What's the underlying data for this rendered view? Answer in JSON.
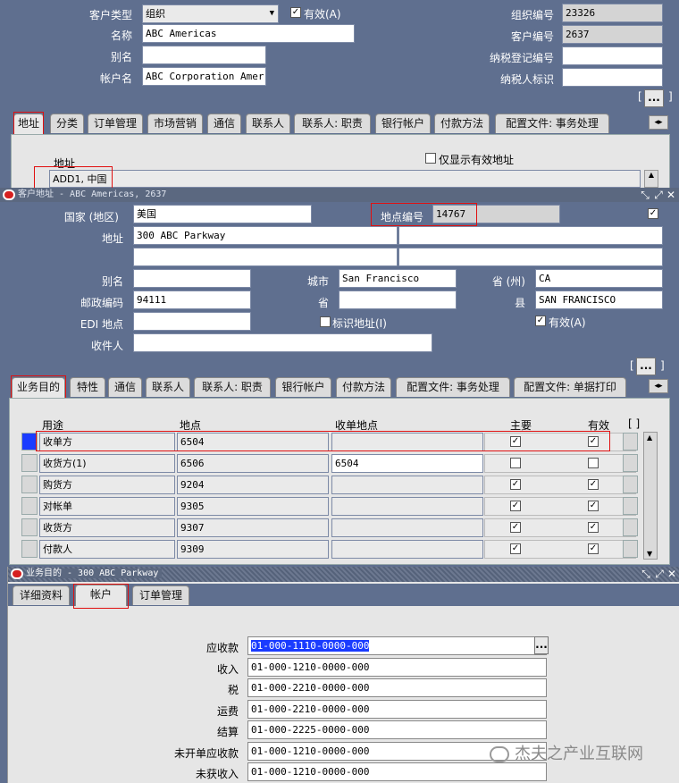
{
  "header": {
    "customer_type_label": "客户类型",
    "customer_type_value": "组织",
    "active_label": "有效(A)",
    "name_label": "名称",
    "name_value": "ABC Americas",
    "alias_label": "别名",
    "alias_value": "",
    "account_name_label": "帐户名",
    "account_name_value": "ABC Corporation Amer",
    "org_number_label": "组织编号",
    "org_number_value": "23326",
    "customer_number_label": "客户编号",
    "customer_number_value": "2637",
    "tax_reg_label": "纳税登记编号",
    "tax_reg_value": "",
    "taxpayer_id_label": "纳税人标识",
    "taxpayer_id_value": "",
    "ellipsis": "..."
  },
  "main_tabs": [
    "地址",
    "分类",
    "订单管理",
    "市场营销",
    "通信",
    "联系人",
    "联系人: 职责",
    "银行帐户",
    "付款方法",
    "配置文件: 事务处理"
  ],
  "address_pane": {
    "address_label": "地址",
    "show_active_label": "仅显示有效地址",
    "address_value": "ADD1, 中国"
  },
  "customer_address_window": {
    "title": "客户地址 - ABC Americas, 2637",
    "country_label": "国家 (地区)",
    "country_value": "美国",
    "site_number_label": "地点编号",
    "site_number_value": "14767",
    "address_label": "地址",
    "address_line1": "300 ABC Parkway",
    "alias_label": "别名",
    "alias_value": "",
    "city_label": "城市",
    "city_value": "San Francisco",
    "province_label": "省 (州)",
    "province_value": "CA",
    "postal_label": "邮政编码",
    "postal_value": "94111",
    "state_label": "省",
    "state_value": "",
    "county_label": "县",
    "county_value": "SAN FRANCISCO",
    "edi_label": "EDI 地点",
    "edi_value": "",
    "identify_addr_label": "标识地址(I)",
    "active_label": "有效(A)",
    "recipient_label": "收件人",
    "recipient_value": "",
    "ellipsis": "..."
  },
  "site_tabs": [
    "业务目的",
    "特性",
    "通信",
    "联系人",
    "联系人: 职责",
    "银行帐户",
    "付款方法",
    "配置文件: 事务处理",
    "配置文件: 单据打印"
  ],
  "site_uses": {
    "columns": {
      "purpose": "用途",
      "location": "地点",
      "bill_to": "收单地点",
      "primary": "主要",
      "active": "有效",
      "bracket": "[ ]"
    },
    "rows": [
      {
        "purpose": "收单方",
        "location": "6504",
        "bill_to": "",
        "primary": true,
        "active": true
      },
      {
        "purpose": "收货方(1)",
        "location": "6506",
        "bill_to": "6504",
        "primary": false,
        "active": false
      },
      {
        "purpose": "购货方",
        "location": "9204",
        "bill_to": "",
        "primary": true,
        "active": true
      },
      {
        "purpose": "对帐单",
        "location": "9305",
        "bill_to": "",
        "primary": true,
        "active": true
      },
      {
        "purpose": "收货方",
        "location": "9307",
        "bill_to": "",
        "primary": true,
        "active": true
      },
      {
        "purpose": "付款人",
        "location": "9309",
        "bill_to": "",
        "primary": true,
        "active": true
      }
    ]
  },
  "business_purpose_window": {
    "title": "业务目的 - 300 ABC Parkway",
    "tabs": [
      "详细资料",
      "帐户",
      "订单管理"
    ],
    "accounts": [
      {
        "label": "应收款",
        "value": "01-000-1110-0000-000"
      },
      {
        "label": "收入",
        "value": "01-000-1210-0000-000"
      },
      {
        "label": "税",
        "value": "01-000-2210-0000-000"
      },
      {
        "label": "运费",
        "value": "01-000-2210-0000-000"
      },
      {
        "label": "结算",
        "value": "01-000-2225-0000-000"
      },
      {
        "label": "未开单应收款",
        "value": "01-000-1210-0000-000"
      },
      {
        "label": "未获收入",
        "value": "01-000-1210-0000-000"
      }
    ],
    "ellipsis": "..."
  },
  "watermark": "杰夫之产业互联网",
  "colors": {
    "background": "#5f6f8f",
    "pane": "#e6e6e6",
    "highlight_red": "#e01010",
    "selection_blue": "#1a3cff",
    "title_bar": "#5b6880"
  }
}
